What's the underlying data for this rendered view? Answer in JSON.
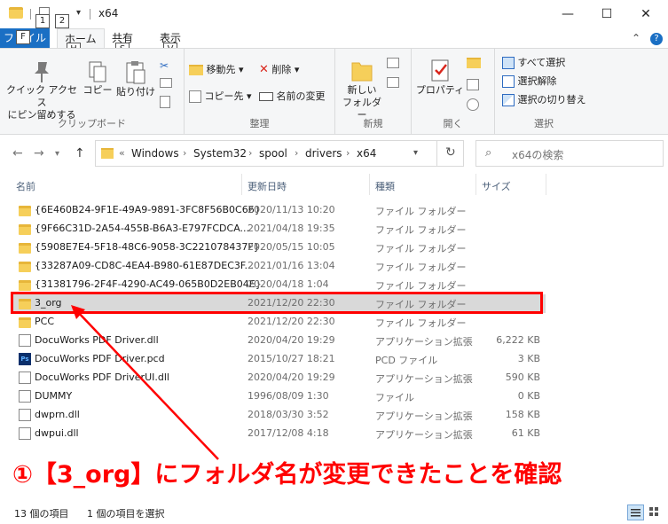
{
  "window": {
    "title": "x64",
    "keytips": [
      "1",
      "2"
    ],
    "minimize_glyph": "—",
    "maximize_glyph": "☐",
    "close_glyph": "✕"
  },
  "tabs": {
    "file": "ファイル",
    "file_keytip": "F",
    "home": "ホーム",
    "home_keytip": "H",
    "share": "共有",
    "share_keytip": "S",
    "view": "表示",
    "view_keytip": "V"
  },
  "ribbon": {
    "clipboard": {
      "label": "クリップボード",
      "pin_line1": "クイック アクセス",
      "pin_line2": "にピン留めする",
      "copy": "コピー",
      "paste": "貼り付け"
    },
    "organize": {
      "label": "整理",
      "move_to": "移動先",
      "copy_to": "コピー先",
      "delete": "削除",
      "rename": "名前の変更"
    },
    "new": {
      "label": "新規",
      "new_folder_line1": "新しい",
      "new_folder_line2": "フォルダー"
    },
    "open": {
      "label": "開く",
      "properties": "プロパティ"
    },
    "select": {
      "label": "選択",
      "select_all": "すべて選択",
      "select_none": "選択解除",
      "invert": "選択の切り替え"
    }
  },
  "address": {
    "prefix": "«",
    "segments": [
      "Windows",
      "System32",
      "spool",
      "drivers",
      "x64"
    ]
  },
  "search": {
    "placeholder": "x64の検索"
  },
  "columns": {
    "name": "名前",
    "date": "更新日時",
    "type": "種類",
    "size": "サイズ"
  },
  "files": [
    {
      "name": "{6E460B24-9F1E-49A9-9891-3FC8F56B0C66}",
      "date": "2020/11/13 10:20",
      "type": "ファイル フォルダー",
      "size": "",
      "kind": "folder"
    },
    {
      "name": "{9F66C31D-2A54-455B-B6A3-E797FCDCA...",
      "date": "2021/04/18 19:35",
      "type": "ファイル フォルダー",
      "size": "",
      "kind": "folder"
    },
    {
      "name": "{5908E7E4-5F18-48C6-9058-3C221078437F}",
      "date": "2020/05/15 10:05",
      "type": "ファイル フォルダー",
      "size": "",
      "kind": "folder"
    },
    {
      "name": "{33287A09-CD8C-4EA4-B980-61E87DEC3F...",
      "date": "2021/01/16 13:04",
      "type": "ファイル フォルダー",
      "size": "",
      "kind": "folder"
    },
    {
      "name": "{31381796-2F4F-4290-AC49-065B0D2EB04E}",
      "date": "2020/04/18 1:04",
      "type": "ファイル フォルダー",
      "size": "",
      "kind": "folder"
    },
    {
      "name": "3_org",
      "date": "2021/12/20 22:30",
      "type": "ファイル フォルダー",
      "size": "",
      "kind": "folder"
    },
    {
      "name": "PCC",
      "date": "2021/12/20 22:30",
      "type": "ファイル フォルダー",
      "size": "",
      "kind": "folder"
    },
    {
      "name": "DocuWorks PDF Driver.dll",
      "date": "2020/04/20 19:29",
      "type": "アプリケーション拡張",
      "size": "6,222 KB",
      "kind": "dll"
    },
    {
      "name": "DocuWorks PDF Driver.pcd",
      "date": "2015/10/27 18:21",
      "type": "PCD ファイル",
      "size": "3 KB",
      "kind": "pcd"
    },
    {
      "name": "DocuWorks PDF DriverUI.dll",
      "date": "2020/04/20 19:29",
      "type": "アプリケーション拡張",
      "size": "590 KB",
      "kind": "dll"
    },
    {
      "name": "DUMMY",
      "date": "1996/08/09 1:30",
      "type": "ファイル",
      "size": "0 KB",
      "kind": "plain"
    },
    {
      "name": "dwprn.dll",
      "date": "2018/03/30 3:52",
      "type": "アプリケーション拡張",
      "size": "158 KB",
      "kind": "dll"
    },
    {
      "name": "dwpui.dll",
      "date": "2017/12/08 4:18",
      "type": "アプリケーション拡張",
      "size": "61 KB",
      "kind": "dll"
    }
  ],
  "annotation": {
    "text": "①【3_org】にフォルダ名が変更できたことを確認",
    "color": "#ff0000"
  },
  "status": {
    "count": "13 個の項目",
    "selected": "1 個の項目を選択"
  },
  "colors": {
    "accent": "#1a6fc4",
    "highlight": "#ff0000",
    "folder": "#f6cf5a"
  }
}
